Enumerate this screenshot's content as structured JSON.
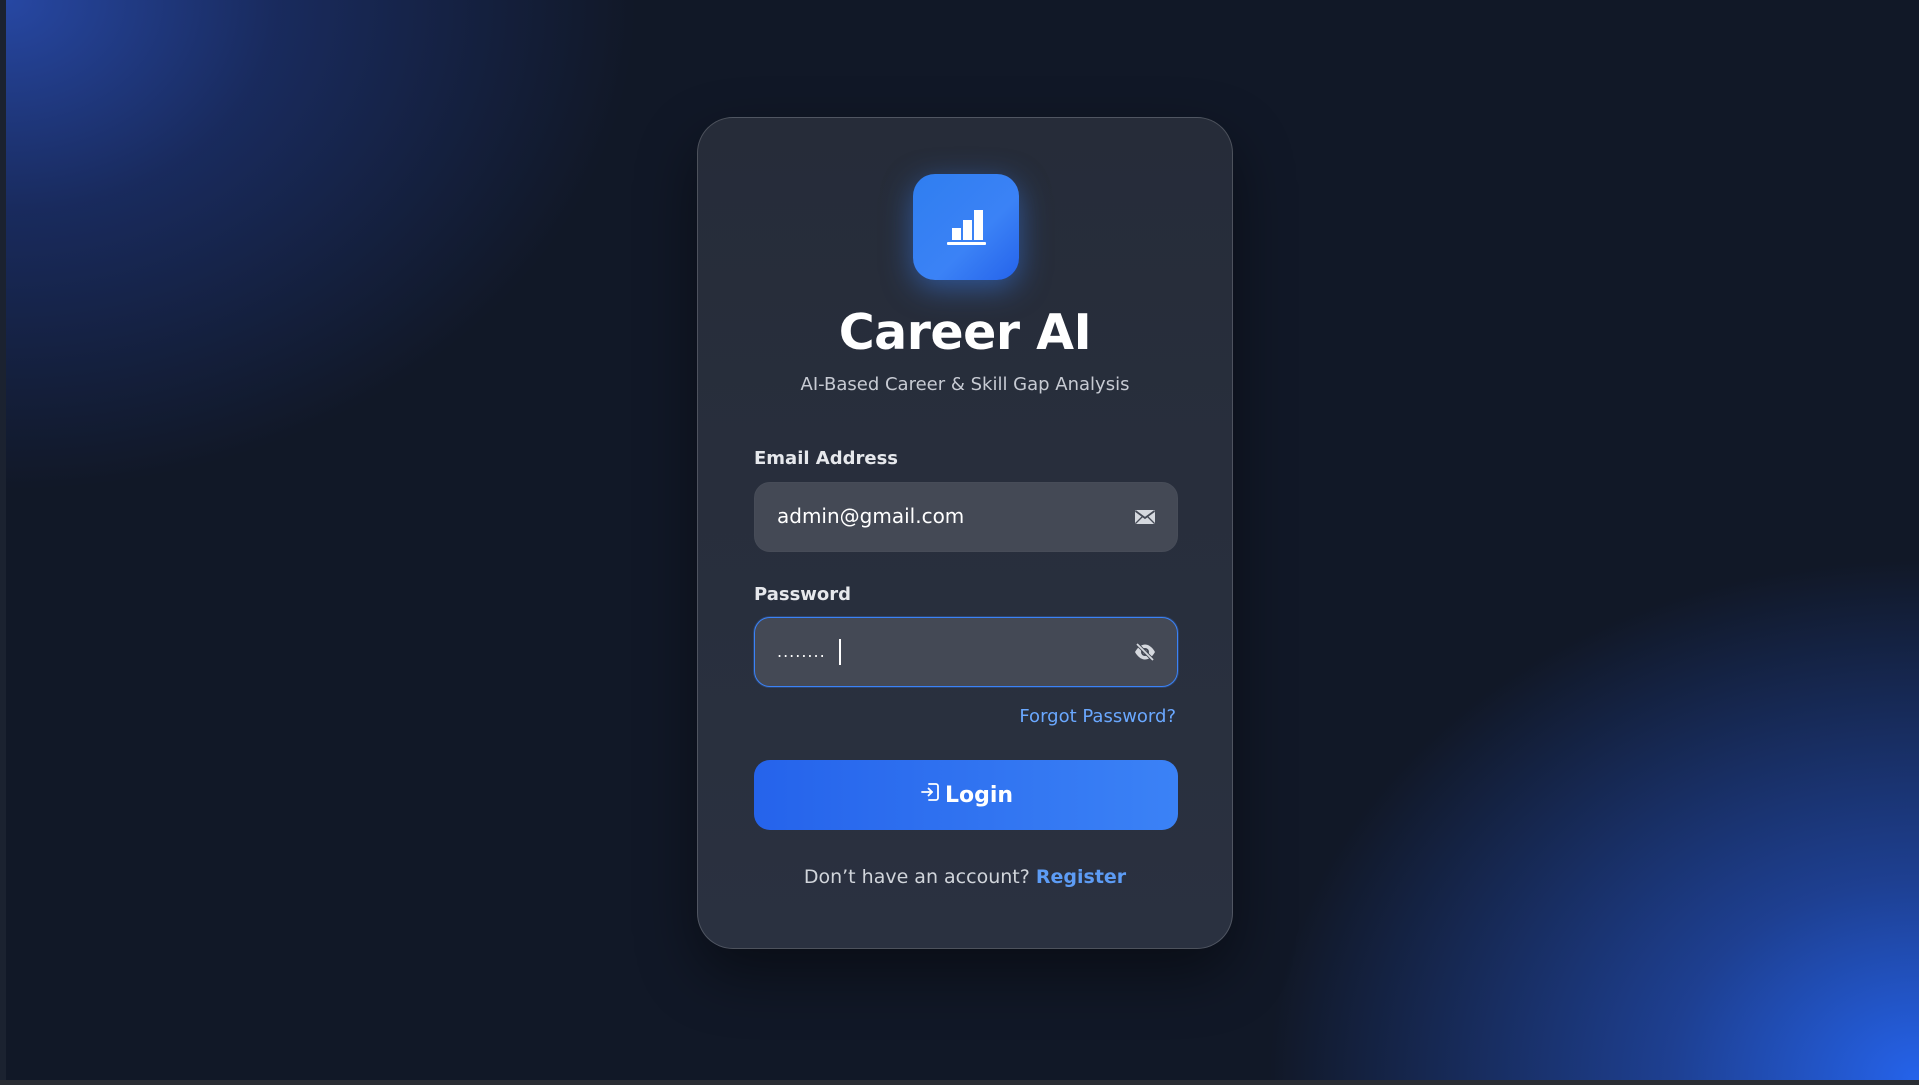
{
  "app": {
    "title": "Career AI",
    "subtitle": "AI-Based Career & Skill Gap Analysis"
  },
  "form": {
    "email_label": "Email Address",
    "email_value": "admin@gmail.com",
    "password_label": "Password",
    "password_value": "........",
    "forgot_label": "Forgot Password?",
    "login_label": "Login",
    "footer_text": "Don’t have an account?",
    "register_label": "Register"
  },
  "icons": {
    "logo": "bar-chart-icon",
    "email": "envelope-icon",
    "password": "eye-slash-icon",
    "login": "login-arrow-icon"
  },
  "colors": {
    "accent": "#3b82f6",
    "link": "#6aa8ff",
    "card": "#262c39",
    "background": "#111827"
  }
}
